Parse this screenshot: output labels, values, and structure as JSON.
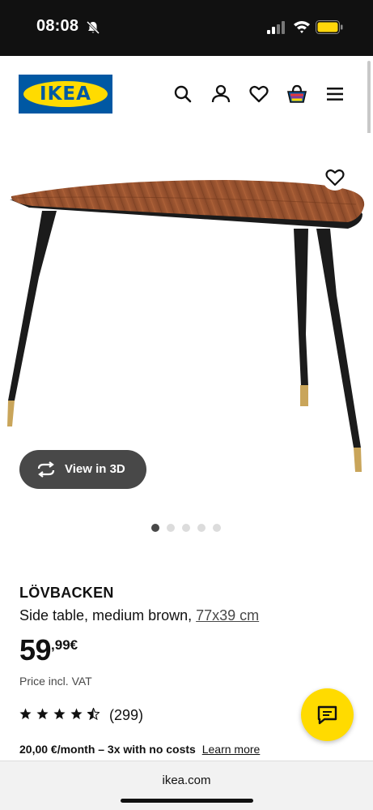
{
  "status_bar": {
    "time": "08:08",
    "icons": [
      "bell-slash-icon",
      "signal-icon",
      "wifi-icon",
      "battery-icon"
    ],
    "battery_color": "#ffd60a"
  },
  "header": {
    "logo_text": "IKEA",
    "brand_colors": {
      "blue": "#0058a3",
      "yellow": "#ffdb00"
    },
    "icons": [
      "search-icon",
      "account-icon",
      "heart-icon",
      "shopping-bag-icon",
      "menu-icon"
    ]
  },
  "gallery": {
    "view_3d_label": "View in 3D",
    "slide_count": 5,
    "active_slide": 1
  },
  "product": {
    "name": "LÖVBACKEN",
    "description": "Side table, medium brown,",
    "size": "77x39 cm",
    "price_integer": "59",
    "price_decimal": ",99€",
    "vat_note": "Price incl. VAT",
    "rating_stars": 4.5,
    "review_count": "(299)",
    "installment_text": "20,00 €/month – 3x with no costs",
    "learn_more": "Learn more"
  },
  "browser": {
    "url": "ikea.com"
  }
}
